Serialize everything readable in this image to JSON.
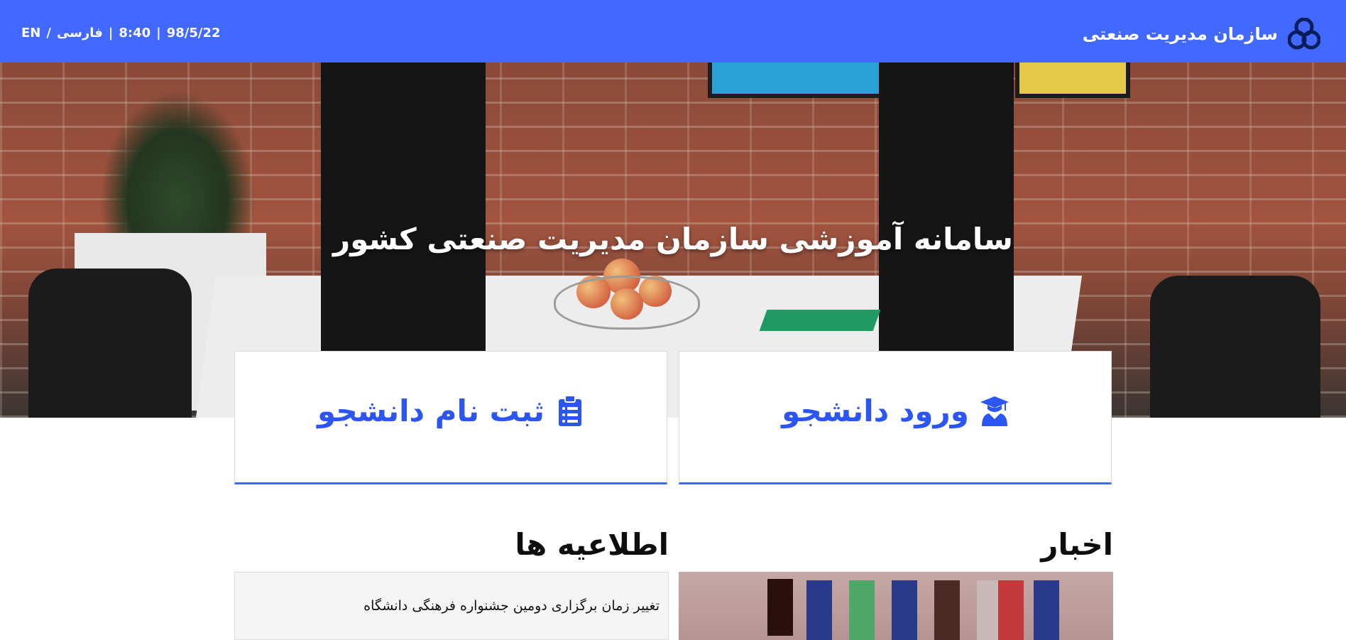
{
  "header": {
    "site_name": "سازمان مدیریت صنعتی",
    "date": "98/5/22",
    "time": "8:40",
    "lang_fa": "فارسی",
    "lang_en": "EN",
    "separator": "|",
    "lang_separator": "/",
    "accent_color": "#4169ff"
  },
  "hero": {
    "title": "سامانه آموزشی سازمان مدیریت صنعتی کشور"
  },
  "cards": [
    {
      "label": "ورود دانشجو",
      "icon": "graduate-icon"
    },
    {
      "label": "ثبت نام دانشجو",
      "icon": "clipboard-list-icon"
    }
  ],
  "sections": {
    "news_title": "اخبار",
    "announcements_title": "اطلاعیه ها",
    "announcements": [
      "تغییر زمان برگزاری دومین جشنواره فرهنگی دانشگاه"
    ]
  }
}
